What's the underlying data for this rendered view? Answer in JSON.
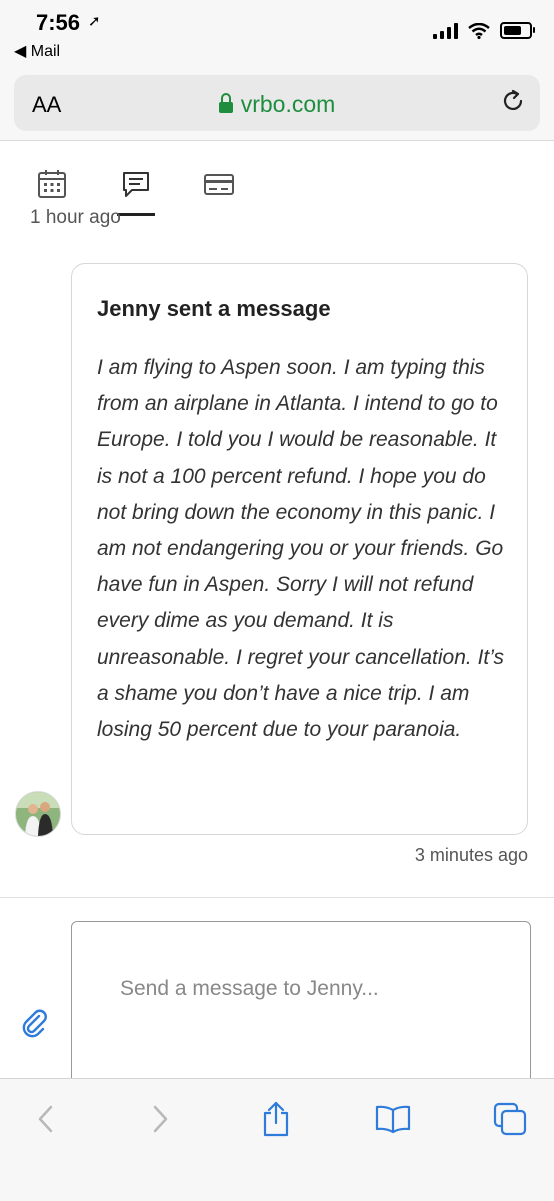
{
  "status_bar": {
    "time": "7:56",
    "back_app": "Mail"
  },
  "browser": {
    "text_size_label": "AA",
    "url": "vrbo.com",
    "accent": "#1e8e3e",
    "icon_color": "#2f7bd9"
  },
  "tabs": [
    {
      "name": "calendar-icon"
    },
    {
      "name": "messages-icon",
      "active": true
    },
    {
      "name": "payment-card-icon"
    }
  ],
  "conversation": {
    "previous_timestamp": "1 hour ago",
    "message": {
      "title": "Jenny sent a message",
      "body": "I am flying to Aspen soon. I am typing this from an airplane in Atlanta. I intend to go to Europe. I told you I would be reasonable. It is not a 100 percent refund. I hope you do not bring down the economy in this panic. I am not endangering you or your friends. Go have fun in Aspen. Sorry I will not refund every dime as you demand. It is unreasonable. I regret your cancellation. It’s a shame you don’t have a nice trip. I am losing 50 percent due to your paranoia.",
      "timestamp": "3 minutes ago"
    }
  },
  "compose": {
    "placeholder": "Send a message to Jenny..."
  },
  "toolbar": [
    "back-icon",
    "forward-icon",
    "share-icon",
    "bookmarks-icon",
    "tabs-icon"
  ]
}
